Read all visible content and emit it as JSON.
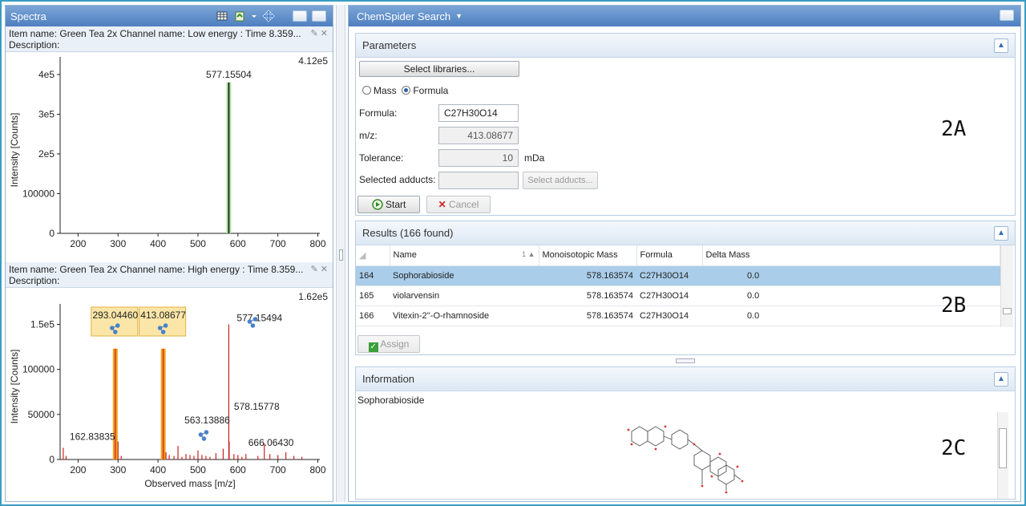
{
  "spectra": {
    "title": "Spectra",
    "top": {
      "header": "Item name: Green Tea 2x   Channel name: Low energy : Time 8.359...",
      "description": "Description:",
      "max": "4.12e5"
    },
    "bottom": {
      "header": "Item name: Green Tea 2x Channel name: High energy : Time 8.359...",
      "description": "Description:",
      "max": "1.62e5"
    }
  },
  "chart_data": [
    {
      "type": "bar",
      "name": "low-energy",
      "ylabel": "Intensity [Counts]",
      "xlabel": "",
      "xlim": [
        155,
        805
      ],
      "ylim": [
        0,
        420000
      ],
      "xticks": [
        "200",
        "300",
        "400",
        "500",
        "600",
        "700",
        "800"
      ],
      "yticks": [
        "0",
        "100000",
        "2e5",
        "3e5",
        "4e5"
      ],
      "peaks": [
        [
          577.155,
          380000
        ]
      ],
      "labels": [
        {
          "x": 577.155,
          "y": 380000,
          "text": "577.15504"
        }
      ]
    },
    {
      "type": "bar",
      "name": "high-energy",
      "ylabel": "Intensity [Counts]",
      "xlabel": "Observed mass [m/z]",
      "xlim": [
        155,
        805
      ],
      "ylim": [
        0,
        162000
      ],
      "xticks": [
        "200",
        "300",
        "400",
        "500",
        "600",
        "700",
        "800"
      ],
      "yticks": [
        "0",
        "50000",
        "100000",
        "1.5e5"
      ],
      "peaks": [
        [
          162.838,
          13000
        ],
        [
          170,
          4000
        ],
        [
          293.045,
          123000
        ],
        [
          300,
          20000
        ],
        [
          308,
          4000
        ],
        [
          413.087,
          123000
        ],
        [
          420,
          8000
        ],
        [
          428,
          5000
        ],
        [
          440,
          4000
        ],
        [
          450,
          15000
        ],
        [
          460,
          3000
        ],
        [
          470,
          6000
        ],
        [
          480,
          5000
        ],
        [
          490,
          4000
        ],
        [
          500,
          10000
        ],
        [
          510,
          5000
        ],
        [
          520,
          4000
        ],
        [
          530,
          3000
        ],
        [
          545,
          7000
        ],
        [
          563.139,
          12000
        ],
        [
          577.155,
          150000
        ],
        [
          578.158,
          20000
        ],
        [
          590,
          6000
        ],
        [
          600,
          5000
        ],
        [
          610,
          3000
        ],
        [
          620,
          6000
        ],
        [
          650,
          4000
        ],
        [
          666.064,
          18000
        ],
        [
          680,
          6000
        ],
        [
          700,
          5000
        ],
        [
          720,
          8000
        ],
        [
          740,
          4000
        ],
        [
          760,
          3000
        ]
      ],
      "highlighted": [
        293.045,
        413.087
      ],
      "labels": [
        {
          "x": 162.838,
          "y": 13000,
          "text": "162.83835"
        },
        {
          "x": 563.139,
          "y": 12000,
          "text": "563.13886"
        },
        {
          "x": 577.155,
          "y": 150000,
          "text": "577.15494"
        },
        {
          "x": 578.158,
          "y": 20000,
          "text": "578.15778"
        },
        {
          "x": 666.064,
          "y": 18000,
          "text": "666.06430"
        }
      ],
      "boxed_labels": [
        {
          "x": 293.045,
          "text": "293.04460"
        },
        {
          "x": 413.087,
          "text": "413.08677"
        }
      ]
    }
  ],
  "chemspider": {
    "title": "ChemSpider Search",
    "parameters": {
      "heading": "Parameters",
      "select_libraries": "Select libraries...",
      "mass_label": "Mass",
      "formula_label": "Formula",
      "formula_field_label": "Formula:",
      "formula_value": "C27H30O14",
      "mz_label": "m/z:",
      "mz_value": "413.08677",
      "tolerance_label": "Tolerance:",
      "tolerance_value": "10",
      "tolerance_unit": "mDa",
      "adducts_label": "Selected adducts:",
      "adducts_value": "",
      "select_adducts": "Select adducts...",
      "start": "Start",
      "cancel": "Cancel"
    },
    "results": {
      "heading": "Results (166 found)",
      "columns": [
        "Name",
        "Monoisotopic Mass",
        "Formula",
        "Delta Mass"
      ],
      "rows": [
        {
          "index": "164",
          "name": "Sophorabioside",
          "mass": "578.163574",
          "formula": "C27H30O14",
          "delta": "0.0"
        },
        {
          "index": "165",
          "name": "violarvensin",
          "mass": "578.163574",
          "formula": "C27H30O14",
          "delta": "0.0"
        },
        {
          "index": "166",
          "name": "Vitexin-2''-O-rhamnoside",
          "mass": "578.163574",
          "formula": "C27H30O14",
          "delta": "0.0"
        }
      ],
      "assign": "Assign"
    },
    "information": {
      "heading": "Information",
      "compound": "Sophorabioside"
    }
  },
  "annotations": {
    "a": "2A",
    "b": "2B",
    "c": "2C"
  },
  "colors": {
    "titlebar": "#5b8ac8",
    "selection": "#aacde9",
    "peak": "#cc2222",
    "highlight": "#f0a020",
    "boxfill": "#fbe6a8"
  }
}
